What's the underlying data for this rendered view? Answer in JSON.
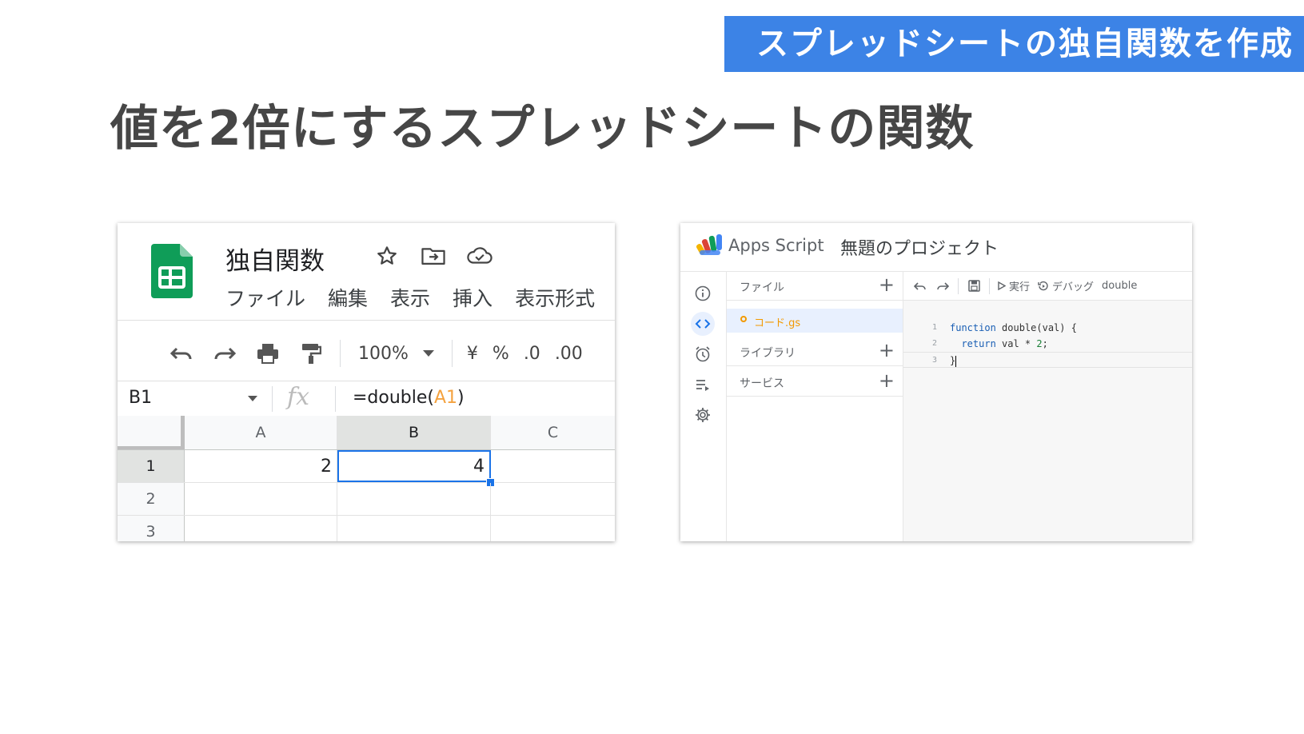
{
  "banner": {
    "text": "スプレッドシートの独自関数を作成"
  },
  "slide_title": "値を2倍にするスプレッドシートの関数",
  "sheets": {
    "doc_title": "独自関数",
    "menu": [
      "ファイル",
      "編集",
      "表示",
      "挿入",
      "表示形式"
    ],
    "toolbar": {
      "zoom": "100%",
      "currency": "¥",
      "percent": "%",
      "decrease_decimal": ".0",
      "increase_decimal": ".00"
    },
    "name_box": "B1",
    "formula": {
      "prefix": "=double(",
      "ref": "A1",
      "suffix": ")"
    },
    "columns": [
      "A",
      "B",
      "C"
    ],
    "rows": [
      "1",
      "2",
      "3"
    ],
    "cells": {
      "A1": "2",
      "B1": "4"
    },
    "colors": {
      "accent": "#1a73e8",
      "sheets_green": "#0f9d58",
      "ref": "#f4a23f"
    }
  },
  "apps_script": {
    "brand": "Apps Script",
    "project": "無題のプロジェクト",
    "files_label": "ファイル",
    "file_name": "コード.gs",
    "libraries_label": "ライブラリ",
    "services_label": "サービス",
    "toolbar": {
      "run": "実行",
      "debug": "デバッグ",
      "function": "double"
    },
    "code": {
      "line_numbers": [
        "1",
        "2",
        "3"
      ],
      "l1_kw": "function",
      "l1_rest": " double(val) {",
      "l2_kw": "return",
      "l2_mid": " val * ",
      "l2_num": "2",
      "l2_end": ";",
      "l3": "}"
    }
  }
}
